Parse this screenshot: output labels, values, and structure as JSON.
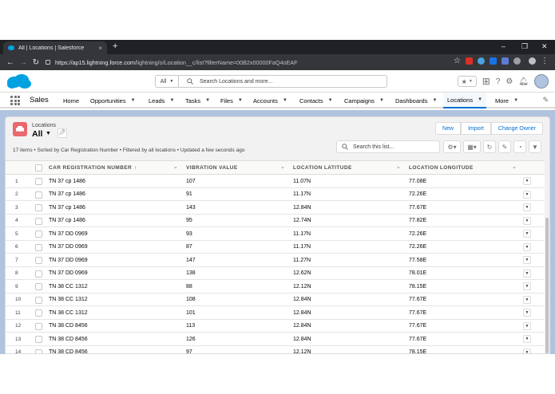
{
  "browser": {
    "tab_title": "All | Locations | Salesforce",
    "new_tab": "+",
    "close_tab": "×",
    "window_controls": [
      "–",
      "❐",
      "✕"
    ],
    "url_host": "https://ap15.lightning.force.com",
    "url_path": "/lightning/o/Location__c/list?filterName=00B2x00000FaQ4oEAF"
  },
  "header": {
    "search_scope": "All",
    "search_placeholder": "Search Locations and more..."
  },
  "nav": {
    "app_name": "Sales",
    "items": [
      {
        "label": "Home",
        "chevron": false
      },
      {
        "label": "Opportunities",
        "chevron": true
      },
      {
        "label": "Leads",
        "chevron": true
      },
      {
        "label": "Tasks",
        "chevron": true
      },
      {
        "label": "Files",
        "chevron": true
      },
      {
        "label": "Accounts",
        "chevron": true
      },
      {
        "label": "Contacts",
        "chevron": true
      },
      {
        "label": "Campaigns",
        "chevron": true
      },
      {
        "label": "Dashboards",
        "chevron": true
      },
      {
        "label": "Locations",
        "chevron": true,
        "active": true
      },
      {
        "label": "More",
        "chevron": true
      }
    ]
  },
  "list": {
    "object_label": "Locations",
    "view_name": "All",
    "buttons": [
      "New",
      "Import",
      "Change Owner"
    ],
    "info": "17 items • Sorted by Car Registration Number • Filtered by all locations • Updated a few seconds ago",
    "search_placeholder": "Search this list..."
  },
  "table": {
    "columns": [
      "Car Registration Number",
      "Vibration Value",
      "Location Latitude",
      "Location Longitude"
    ],
    "sort_indicator": "↑",
    "rows": [
      {
        "n": "1",
        "reg": "TN 37 cp 1486",
        "vib": "107",
        "lat": "11.07N",
        "lon": "77.08E"
      },
      {
        "n": "2",
        "reg": "TN 37 cp 1486",
        "vib": "91",
        "lat": "11.17N",
        "lon": "72.26E"
      },
      {
        "n": "3",
        "reg": "TN 37 cp 1486",
        "vib": "143",
        "lat": "12.84N",
        "lon": "77.67E"
      },
      {
        "n": "4",
        "reg": "TN 37 cp 1486",
        "vib": "95",
        "lat": "12.74N",
        "lon": "77.82E"
      },
      {
        "n": "5",
        "reg": "TN 37 DD 0969",
        "vib": "93",
        "lat": "11.17N",
        "lon": "72.26E"
      },
      {
        "n": "6",
        "reg": "TN 37 DD 0969",
        "vib": "87",
        "lat": "11.17N",
        "lon": "72.26E"
      },
      {
        "n": "7",
        "reg": "TN 37 DD 0969",
        "vib": "147",
        "lat": "11.27N",
        "lon": "77.58E"
      },
      {
        "n": "8",
        "reg": "TN 37 DD 0969",
        "vib": "138",
        "lat": "12.62N",
        "lon": "78.01E"
      },
      {
        "n": "9",
        "reg": "TN 38 CC 1312",
        "vib": "88",
        "lat": "12.12N",
        "lon": "78.15E"
      },
      {
        "n": "10",
        "reg": "TN 38 CC 1312",
        "vib": "108",
        "lat": "12.84N",
        "lon": "77.67E"
      },
      {
        "n": "11",
        "reg": "TN 38 CC 1312",
        "vib": "101",
        "lat": "12.84N",
        "lon": "77.67E"
      },
      {
        "n": "12",
        "reg": "TN 38 CD 8456",
        "vib": "113",
        "lat": "12.84N",
        "lon": "77.67E"
      },
      {
        "n": "13",
        "reg": "TN 38 CD 8456",
        "vib": "126",
        "lat": "12.84N",
        "lon": "77.67E"
      },
      {
        "n": "14",
        "reg": "TN 38 CD 8456",
        "vib": "97",
        "lat": "12.12N",
        "lon": "78.15E"
      }
    ]
  },
  "icons": {
    "search": "search-icon",
    "waffle": "app-launcher-icon",
    "pin": "pin-icon",
    "edit": "pencil-icon"
  },
  "colors": {
    "brand": "#00a1e0",
    "object_icon": "#e9696e",
    "link": "#0070d2",
    "background": "#b0c4df"
  }
}
